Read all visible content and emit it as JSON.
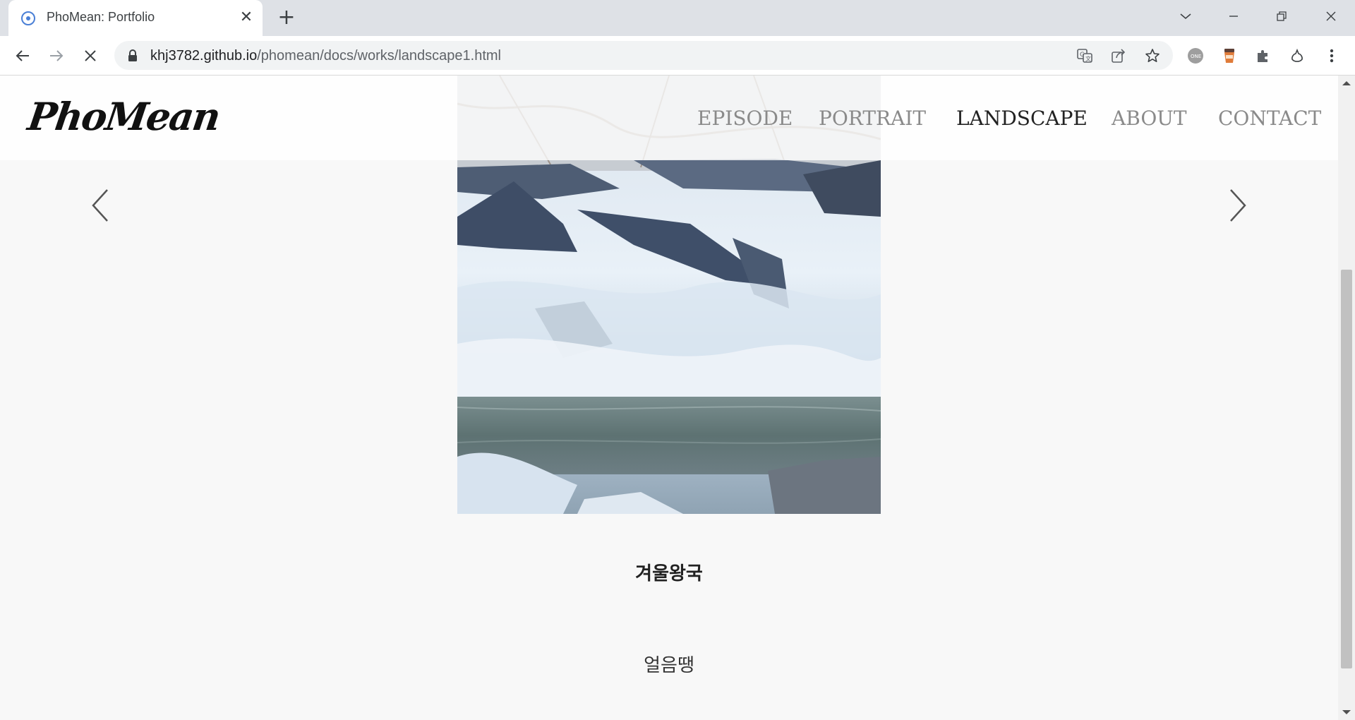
{
  "browser": {
    "tab_title": "PhoMean: Portfolio",
    "url_host": "khj3782.github.io",
    "url_path": "/phomean/docs/works/landscape1.html"
  },
  "site": {
    "logo": "PhoMean",
    "nav": [
      "EPISODE",
      "PORTRAIT",
      "LANDSCAPE",
      "ABOUT",
      "CONTACT"
    ],
    "active_nav": "LANDSCAPE"
  },
  "work": {
    "title": "겨울왕국",
    "subtitle": "얼음땡"
  }
}
